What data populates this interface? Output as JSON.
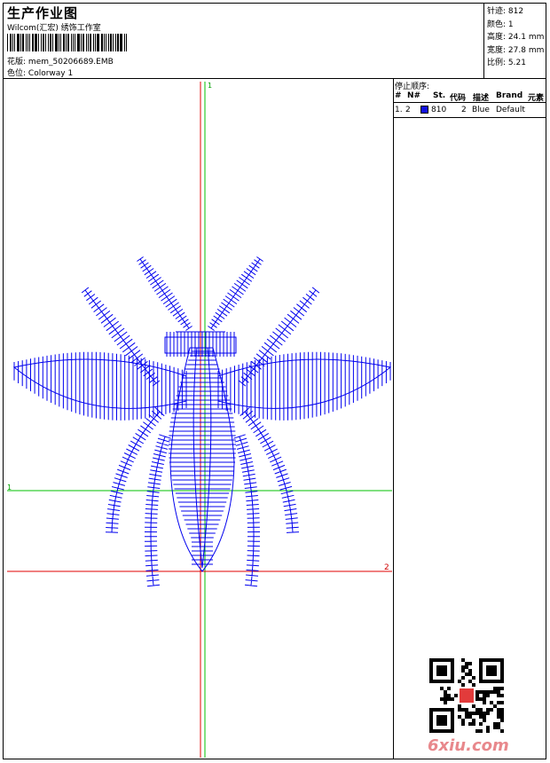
{
  "header": {
    "title": "生产作业图",
    "studio": "Wilcom(汇宏) 绣饰工作室",
    "design_label": "花版:",
    "design_value": "mem_50206689.EMB",
    "colorway_label": "色位:",
    "colorway_value": "Colorway 1"
  },
  "stats": [
    {
      "label": "针迹:",
      "value": "812"
    },
    {
      "label": "颜色:",
      "value": "1"
    },
    {
      "label": "高度:",
      "value": "24.1 mm"
    },
    {
      "label": "宽度:",
      "value": "27.8 mm"
    },
    {
      "label": "比例:",
      "value": "5.21"
    }
  ],
  "stop_sequence": {
    "title": "停止顺序:",
    "columns": [
      "#",
      "N#",
      "St.",
      "代码",
      "描述",
      "Brand",
      "元素"
    ],
    "rows": [
      {
        "num": "1.",
        "n": "2",
        "color": "#1010e0",
        "st": "810",
        "code": "2",
        "desc": "Blue",
        "brand": "Default",
        "element": ""
      }
    ]
  },
  "axes": {
    "green_v_label": "1",
    "green_h_label": "1",
    "red_h_label": "2",
    "red_v_label": "2"
  },
  "design": {
    "stitch_color": "#0000ee",
    "guide_green": "#00c000",
    "guide_red": "#e00000"
  },
  "watermark": {
    "text": "6xiu.com",
    "seal_text": "汇宏"
  }
}
